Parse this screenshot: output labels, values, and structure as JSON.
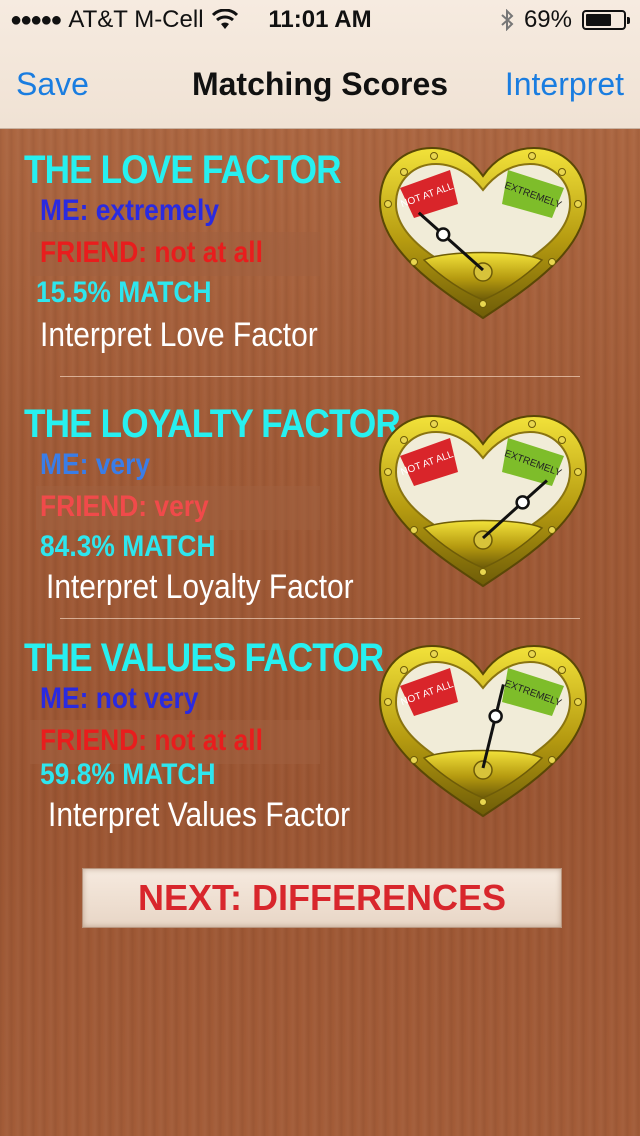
{
  "status_bar": {
    "carrier": "AT&T M-Cell",
    "time": "11:01 AM",
    "battery_percent": "69%",
    "battery_level": 0.69
  },
  "nav": {
    "left_button": "Save",
    "title": "Matching Scores",
    "right_button": "Interpret"
  },
  "factors": [
    {
      "title": "THE LOVE FACTOR",
      "me": "ME: extremely",
      "friend": "FRIEND: not at all",
      "match": "15.5% MATCH",
      "link": "Interpret Love Factor",
      "me_color": "#2a2ae0",
      "friend_color": "#e81d1d",
      "gauge": {
        "low_label": "NOT AT ALL",
        "high_label": "EXTREMELY",
        "needle_level": 0.155
      }
    },
    {
      "title": "THE LOYALTY FACTOR",
      "me": "ME: very",
      "friend": "FRIEND: very",
      "match": "84.3% MATCH",
      "link": "Interpret Loyalty Factor",
      "me_color": "#3a7de8",
      "friend_color": "#f04a4a",
      "gauge": {
        "low_label": "NOT AT ALL",
        "high_label": "EXTREMELY",
        "needle_level": 0.843
      }
    },
    {
      "title": "THE VALUES FACTOR",
      "me": "ME: not very",
      "friend": "FRIEND: not at all",
      "match": "59.8% MATCH",
      "link": "Interpret Values Factor",
      "me_color": "#2a2ae0",
      "friend_color": "#e81d1d",
      "gauge": {
        "low_label": "NOT AT ALL",
        "high_label": "EXTREMELY",
        "needle_level": 0.598
      }
    }
  ],
  "next_button": "NEXT: DIFFERENCES",
  "colors": {
    "nav_link": "#1a7de0",
    "title_cyan": "#27f0f0",
    "button_text": "#d8262c"
  }
}
